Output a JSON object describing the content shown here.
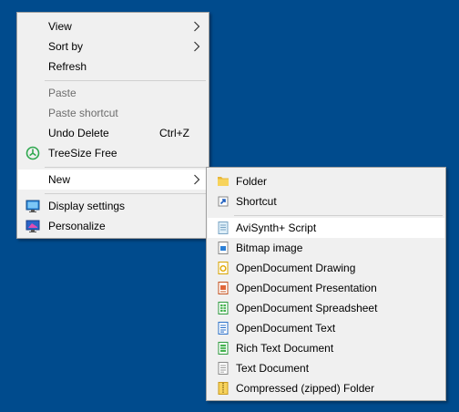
{
  "desktop_menu": {
    "items": [
      {
        "label": "View"
      },
      {
        "label": "Sort by"
      },
      {
        "label": "Refresh"
      },
      {
        "label": "Paste"
      },
      {
        "label": "Paste shortcut"
      },
      {
        "label": "Undo Delete",
        "shortcut": "Ctrl+Z"
      },
      {
        "label": "TreeSize Free",
        "icon": "treesize-icon"
      },
      {
        "label": "New"
      },
      {
        "label": "Display settings",
        "icon": "display-icon"
      },
      {
        "label": "Personalize",
        "icon": "personalize-icon"
      }
    ]
  },
  "new_menu": {
    "items": [
      {
        "label": "Folder",
        "icon": "folder-icon"
      },
      {
        "label": "Shortcut",
        "icon": "shortcut-icon"
      },
      {
        "label": "AviSynth+ Script",
        "icon": "avisynth-script-icon"
      },
      {
        "label": "Bitmap image",
        "icon": "bitmap-icon"
      },
      {
        "label": "OpenDocument Drawing",
        "icon": "odg-icon"
      },
      {
        "label": "OpenDocument Presentation",
        "icon": "odp-icon"
      },
      {
        "label": "OpenDocument Spreadsheet",
        "icon": "ods-icon"
      },
      {
        "label": "OpenDocument Text",
        "icon": "odt-icon"
      },
      {
        "label": "Rich Text Document",
        "icon": "rtf-icon"
      },
      {
        "label": "Text Document",
        "icon": "txt-icon"
      },
      {
        "label": "Compressed (zipped) Folder",
        "icon": "zip-folder-icon"
      }
    ]
  },
  "colors": {
    "desktop_background": "#004b8d",
    "menu_background": "#f0f0f0",
    "highlight": "#ffffff",
    "disabled_text": "#6d6d6d"
  }
}
